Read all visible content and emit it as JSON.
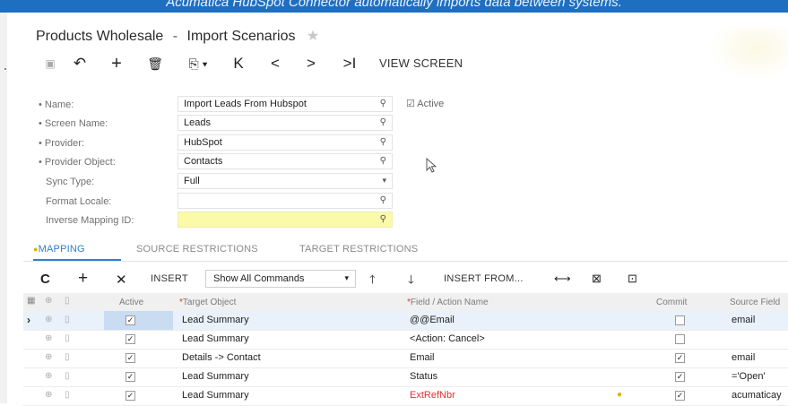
{
  "banner": {
    "text": "Acumatica HubSpot Connector automatically imports data between systems."
  },
  "title": {
    "main": "Products Wholesale",
    "separator": "-",
    "page": "Import Scenarios",
    "star": "★"
  },
  "toolbar": {
    "save": "▣",
    "undo": "↶",
    "add": "+",
    "delete": "🗑",
    "copy": "⎘ ▾",
    "first": "K",
    "prev": "<",
    "next": ">",
    "last": ">I",
    "view_screen": "VIEW SCREEN"
  },
  "form": {
    "name": {
      "label": "• Name:",
      "value": "Import Leads From Hubspot"
    },
    "screen_name": {
      "label": "• Screen Name:",
      "value": "Leads"
    },
    "provider": {
      "label": "• Provider:",
      "value": "HubSpot"
    },
    "provider_object": {
      "label": "• Provider Object:",
      "value": "Contacts"
    },
    "sync_type": {
      "label": "Sync Type:",
      "value": "Full"
    },
    "format_locale": {
      "label": "Format Locale:",
      "value": ""
    },
    "inverse_mapping": {
      "label": "Inverse Mapping ID:",
      "value": ""
    },
    "active_label": "☑ Active",
    "lookup_icon": "⚲",
    "dropdown_icon": "▾"
  },
  "tabs": [
    {
      "label": "MAPPING"
    },
    {
      "label": "SOURCE RESTRICTIONS"
    },
    {
      "label": "TARGET RESTRICTIONS"
    }
  ],
  "grid_toolbar": {
    "refresh": "C",
    "add": "+",
    "remove": "✕",
    "insert": "INSERT",
    "commands_select": "Show All Commands",
    "up": "🡑",
    "down": "🡓",
    "insert_from": "INSERT FROM...",
    "fit": "⟷",
    "export": "⊠",
    "upload": "⊡"
  },
  "table": {
    "headers": {
      "active": "Active",
      "target_object": "Target Object",
      "field_action": "Field / Action Name",
      "commit": "Commit",
      "source_field": "Source Field"
    },
    "rows": [
      {
        "active": true,
        "target": "Lead Summary",
        "field": "@@Email",
        "commit": false,
        "source": "email"
      },
      {
        "active": true,
        "target": "Lead Summary",
        "field": "<Action: Cancel>",
        "commit": false,
        "source": ""
      },
      {
        "active": true,
        "target": "Details -> Contact",
        "field": "Email",
        "commit": true,
        "source": "email"
      },
      {
        "active": true,
        "target": "Lead Summary",
        "field": "Status",
        "commit": true,
        "source": "='Open'"
      },
      {
        "active": true,
        "target": "Lead Summary",
        "field": "ExtRefNbr",
        "commit": true,
        "source": "acumaticay"
      }
    ]
  },
  "colors": {
    "accent": "#2f7fd1",
    "banner": "#1f6fc1",
    "highlight": "#fafaa8",
    "selected": "#c9dcf2"
  }
}
